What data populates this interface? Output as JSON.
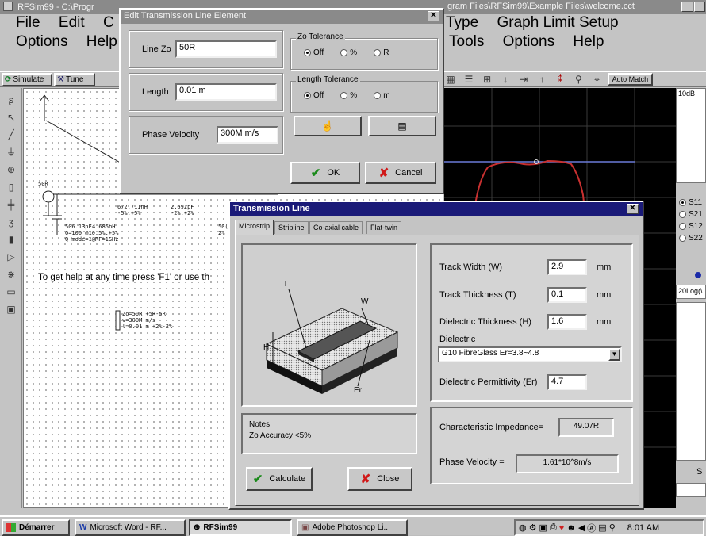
{
  "desktop": {
    "background": "#b8b8b8"
  },
  "main_window": {
    "title": "RFSim99 - C:\\Progr",
    "title_right": "gram Files\\RFSim99\\Example Files\\welcome.cct",
    "menu_row1_left": [
      "File",
      "Edit",
      "C"
    ],
    "menu_row2_left": [
      "Options",
      "Help"
    ],
    "menu_row1_right": [
      "Type",
      "Graph Limit Setup"
    ],
    "menu_row2_right": [
      "Tools",
      "Options",
      "Help"
    ],
    "toolbar": {
      "simulate": "Simulate",
      "tune": "Tune",
      "auto_match": "Auto Match"
    },
    "help_text": "To get help at any time press 'F1' or use th",
    "schematic": {
      "source_label": "50R",
      "c1": "506.13pF\nQ=100 @10.5%,+5%\nQ mode=1@RF=1GHz",
      "l1": "672.711nH\n-5%,+5%",
      "c2": "2.692pF\n-2%,+2%",
      "l2_frag": "4.685nH",
      "right_frag": "50(\n2%",
      "tline": "Zo=50R +5R-5R\nv=300M m/s\nl=0.01 m +2%-2%"
    },
    "graph": {
      "scale_label": "10dB",
      "radio_options": [
        "S11",
        "S21",
        "S12",
        "S22"
      ],
      "selected_radio": "S11",
      "units_label": "20Log(\\",
      "s_frag": "S"
    }
  },
  "edit_dialog": {
    "title": "Edit Transmission Line Element",
    "line_zo": {
      "label": "Line Zo",
      "value": "50R"
    },
    "length": {
      "label": "Length",
      "value": "0.01 m"
    },
    "phase_velocity": {
      "label": "Phase Velocity",
      "value": "300M m/s"
    },
    "zo_tolerance": {
      "label": "Zo Tolerance",
      "options": [
        "Off",
        "%",
        "R"
      ],
      "selected": "Off"
    },
    "length_tolerance": {
      "label": "Length Tolerance",
      "options": [
        "Off",
        "%",
        "m"
      ],
      "selected": "Off"
    },
    "ok": "OK",
    "cancel": "Cancel"
  },
  "tline_dialog": {
    "title": "Transmission Line",
    "tabs": [
      "Microstrip",
      "Stripline",
      "Co-axial cable",
      "Flat-twin"
    ],
    "active_tab": "Microstrip",
    "diagram_labels": {
      "t": "T",
      "w": "W",
      "h": "H",
      "er": "Er"
    },
    "track_width": {
      "label": "Track Width (W)",
      "value": "2.9",
      "unit": "mm"
    },
    "track_thickness": {
      "label": "Track Thickness (T)",
      "value": "0.1",
      "unit": "mm"
    },
    "dielectric_thickness": {
      "label": "Dielectric Thickness (H)",
      "value": "1.6",
      "unit": "mm"
    },
    "dielectric": {
      "label": "Dielectric",
      "value": "G10 FibreGlass Er=3.8~4.8"
    },
    "dielectric_permittivity": {
      "label": "Dielectric Permittivity (Er)",
      "value": "4.7"
    },
    "notes": {
      "label": "Notes:",
      "text": "Zo Accuracy <5%"
    },
    "char_impedance": {
      "label": "Characteristic Impedance=",
      "value": "49.07R"
    },
    "phase_velocity": {
      "label": "Phase Velocity =",
      "value": "1.61*10^8m/s"
    },
    "calculate": "Calculate",
    "close": "Close"
  },
  "taskbar": {
    "start": "Démarrer",
    "items": [
      "Microsoft Word - RF...",
      "RFSim99",
      "Adobe Photoshop Li..."
    ],
    "clock": "8:01 AM"
  }
}
